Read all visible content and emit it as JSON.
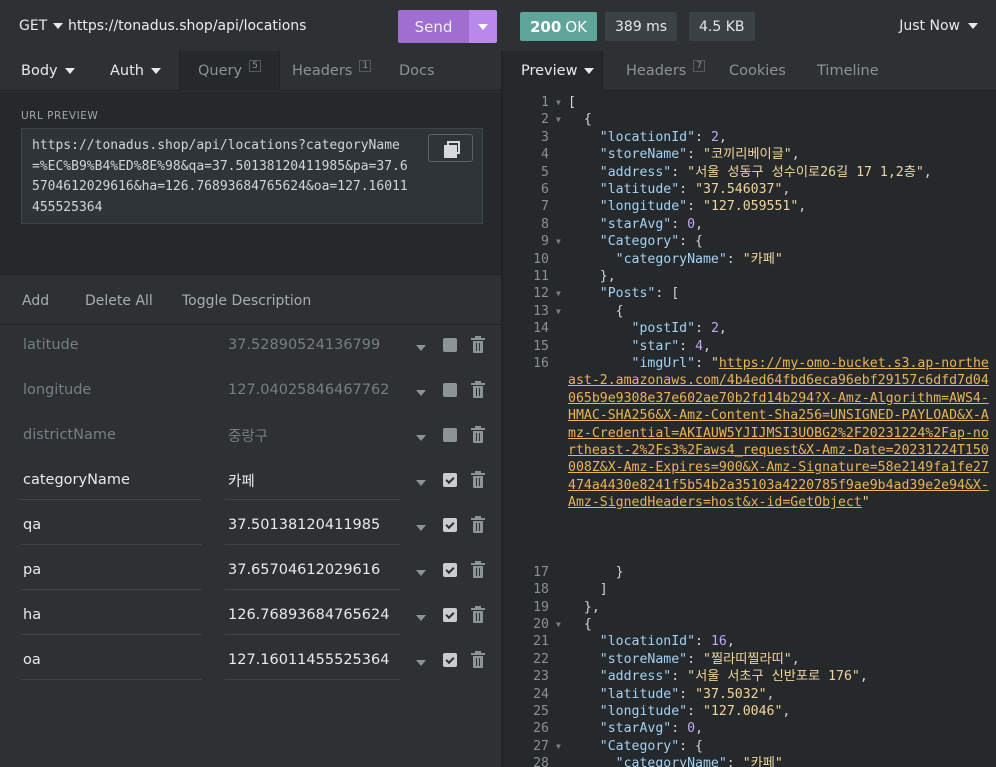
{
  "request": {
    "method": "GET",
    "url": "https://tonadus.shop/api/locations",
    "send_label": "Send"
  },
  "response_meta": {
    "status_code": "200",
    "status_text": "OK",
    "time": "389 ms",
    "size": "4.5 KB",
    "history": "Just Now"
  },
  "left_tabs": {
    "body": "Body",
    "auth": "Auth",
    "query": "Query",
    "query_count": "5",
    "headers": "Headers",
    "headers_count": "1",
    "docs": "Docs"
  },
  "url_preview": {
    "label": "URL PREVIEW",
    "value": "https://tonadus.shop/api/locations?categoryName=%EC%B9%B4%ED%8E%98&qa=37.50138120411985&pa=37.65704612029616&ha=126.76893684765624&oa=127.16011455525364"
  },
  "param_actions": {
    "add": "Add",
    "delete_all": "Delete All",
    "toggle_description": "Toggle Description"
  },
  "params": [
    {
      "name": "latitude",
      "value": "37.52890524136799",
      "enabled": false
    },
    {
      "name": "longitude",
      "value": "127.04025846467762",
      "enabled": false
    },
    {
      "name": "districtName",
      "value": "중랑구",
      "enabled": false
    },
    {
      "name": "categoryName",
      "value": "카페",
      "enabled": true
    },
    {
      "name": "qa",
      "value": "37.50138120411985",
      "enabled": true
    },
    {
      "name": "pa",
      "value": "37.65704612029616",
      "enabled": true
    },
    {
      "name": "ha",
      "value": "126.76893684765624",
      "enabled": true
    },
    {
      "name": "oa",
      "value": "127.16011455525364",
      "enabled": true
    }
  ],
  "right_tabs": {
    "preview": "Preview",
    "headers": "Headers",
    "headers_count": "7",
    "cookies": "Cookies",
    "timeline": "Timeline"
  },
  "response_body": {
    "locations": [
      {
        "locationId": "2",
        "storeName": "\"코끼리베이글\"",
        "address": "\"서울 성동구 성수이로26길 17 1,2층\"",
        "latitude": "\"37.546037\"",
        "longitude": "\"127.059551\"",
        "starAvg": "0",
        "categoryName": "\"카페\"",
        "postId": "2",
        "star": "4",
        "imgUrl": "https://my-omo-bucket.s3.ap-northeast-2.amazonaws.com/4b4ed64fbd6eca96ebf29157c6dfd7d04065b9e9308e37e602ae70b2fd14b294?X-Amz-Algorithm=AWS4-HMAC-SHA256&X-Amz-Content-Sha256=UNSIGNED-PAYLOAD&X-Amz-Credential=AKIAUW5YJIJMSI3UOBG2%2F20231224%2Fap-northeast-2%2Fs3%2Faws4_request&X-Amz-Date=20231224T150008Z&X-Amz-Expires=900&X-Amz-Signature=58e2149fa1fe27474a4430e8241f5b54b2a35103a4220785f9ae9b4ad39e2e94&X-Amz-SignedHeaders=host&x-id=GetObject"
      },
      {
        "locationId": "16",
        "storeName": "\"찔라띠찔라띠\"",
        "address": "\"서울 서초구 신반포로 176\"",
        "latitude": "\"37.5032\"",
        "longitude": "\"127.0046\"",
        "starAvg": "0",
        "categoryName": "\"카페\""
      }
    ]
  },
  "colors": {
    "accent_send": "#9e6ed1",
    "status_ok": "#5fa59a",
    "json_key": "#a7d1f0",
    "json_string": "#f1d59e",
    "json_number": "#c5a5f0",
    "json_link": "#e9b45a"
  },
  "icons": {
    "method_dropdown": "caret-down-icon",
    "copy": "copy-icon",
    "param_checkbox": "checkbox-icon",
    "param_delete": "trash-icon",
    "fold": "fold-arrow-icon"
  }
}
